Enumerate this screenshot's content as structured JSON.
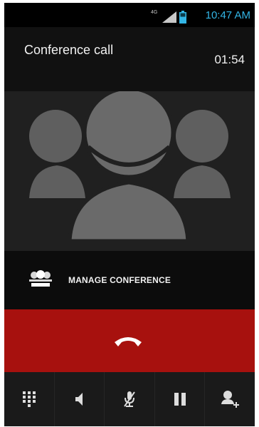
{
  "status_bar": {
    "network_type": "4G",
    "signal_icon": "signal-icon",
    "battery_icon": "battery-icon",
    "time": "10:47 AM",
    "accent_color": "#33b5e5"
  },
  "call": {
    "title": "Conference call",
    "elapsed": "01:54"
  },
  "photo": {
    "icon": "conference-avatar-icon"
  },
  "manage": {
    "icon": "manage-conference-icon",
    "label": "MANAGE CONFERENCE"
  },
  "end_call": {
    "icon": "end-call-icon",
    "color": "#a7110e"
  },
  "controls": [
    {
      "name": "dialpad",
      "icon": "dialpad-icon"
    },
    {
      "name": "speaker",
      "icon": "speaker-icon"
    },
    {
      "name": "mute",
      "icon": "mute-mic-icon"
    },
    {
      "name": "hold",
      "icon": "pause-icon"
    },
    {
      "name": "add-call",
      "icon": "add-call-icon"
    }
  ]
}
